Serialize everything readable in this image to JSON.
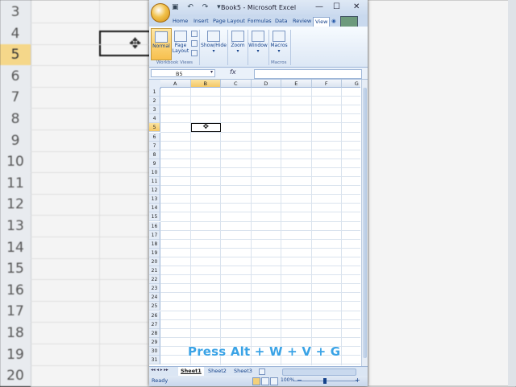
{
  "background": {
    "row_numbers": [
      "3",
      "4",
      "5",
      "6",
      "7",
      "8",
      "9",
      "10",
      "11",
      "12",
      "13",
      "14",
      "15",
      "16",
      "17",
      "18",
      "19",
      "20"
    ],
    "selected_row": "5"
  },
  "window": {
    "title": "Book5 - Microsoft Excel",
    "minimize_label": "—",
    "maximize_label": "☐",
    "close_label": "✕",
    "qat": "▣ ↶ ↷ ▾"
  },
  "tabs": [
    {
      "label": "Home"
    },
    {
      "label": "Insert"
    },
    {
      "label": "Page Layout"
    },
    {
      "label": "Formulas"
    },
    {
      "label": "Data"
    },
    {
      "label": "Review"
    },
    {
      "label": "View"
    }
  ],
  "ribbon": {
    "normal": "Normal",
    "page_layout": "Page Layout",
    "show_hide": "Show/Hide",
    "zoom": "Zoom",
    "window": "Window",
    "macros": "Macros",
    "group_workbook_views": "Workbook Views",
    "group_macros": "Macros"
  },
  "formula_bar": {
    "name_box": "B5",
    "fx": "fx"
  },
  "grid": {
    "columns": [
      "A",
      "B",
      "C",
      "D",
      "E",
      "F",
      "G"
    ],
    "selected_column": "B",
    "rows": [
      "1",
      "2",
      "3",
      "4",
      "5",
      "6",
      "7",
      "8",
      "9",
      "10",
      "11",
      "12",
      "13",
      "14",
      "15",
      "16",
      "17",
      "18",
      "19",
      "20",
      "21",
      "22",
      "23",
      "24",
      "25",
      "26",
      "27",
      "28",
      "29",
      "30",
      "31"
    ],
    "selected_row": "5",
    "cursor": "✥"
  },
  "sheets": [
    {
      "label": "Sheet1",
      "active": true
    },
    {
      "label": "Sheet2",
      "active": false
    },
    {
      "label": "Sheet3",
      "active": false
    }
  ],
  "sheet_nav": "◂◂ ◂ ▸ ▸▸",
  "status": {
    "text": "Ready",
    "zoom": "100%",
    "zoom_minus": "−",
    "zoom_plus": "+"
  },
  "caption": "Press Alt + W + V + G",
  "colors": {
    "accent": "#15428b",
    "selection": "#f4c766",
    "caption": "#3aa3e6"
  }
}
